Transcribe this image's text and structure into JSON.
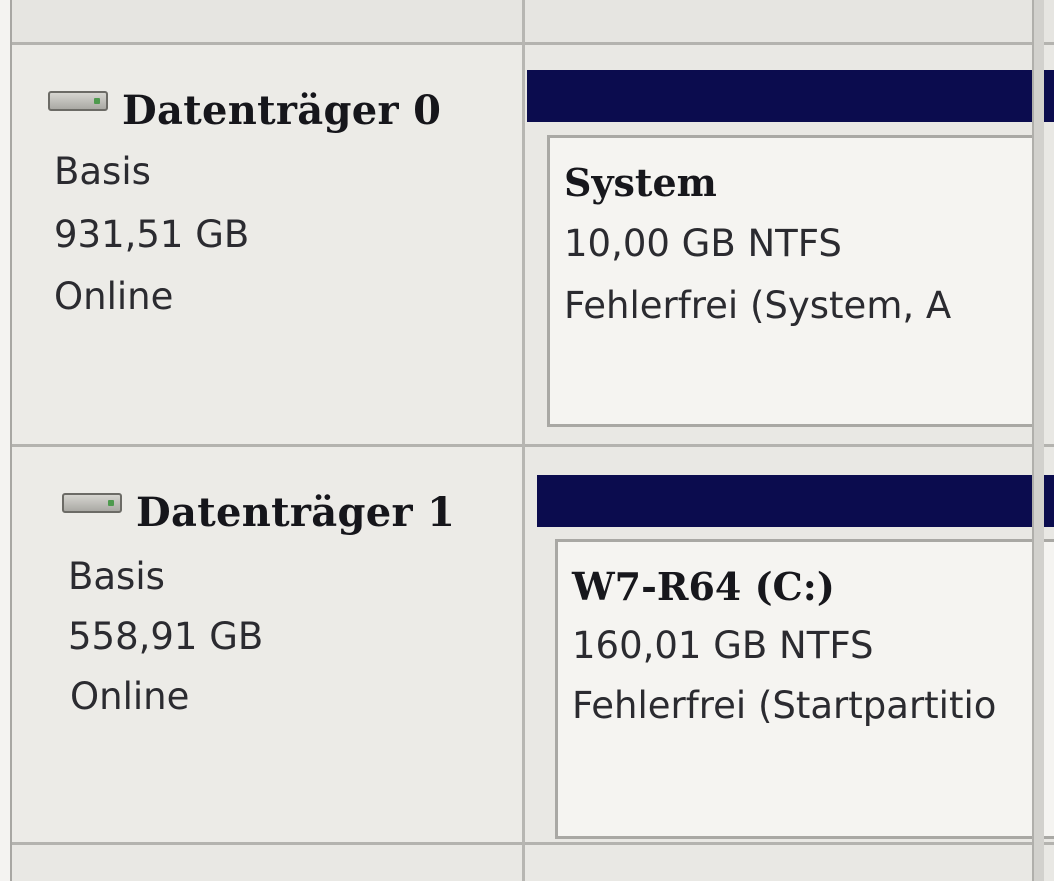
{
  "disks": [
    {
      "title": "Datenträger 0",
      "icon": "hard-disk-icon",
      "type": "Basis",
      "size": "931,51 GB",
      "status": "Online",
      "partition": {
        "name": "System",
        "size_fs": "10,00 GB NTFS",
        "state": "Fehlerfrei (System, A"
      }
    },
    {
      "title": "Datenträger 1",
      "icon": "hard-disk-icon",
      "type": "Basis",
      "size": "558,91 GB",
      "status": "Online",
      "partition": {
        "name": "W7-R64  (C:)",
        "size_fs": "160,01 GB NTFS",
        "state": "Fehlerfrei (Startpartitio"
      }
    }
  ],
  "colors": {
    "partition_header": "#0b0c4e",
    "background": "#e9e8e4"
  }
}
